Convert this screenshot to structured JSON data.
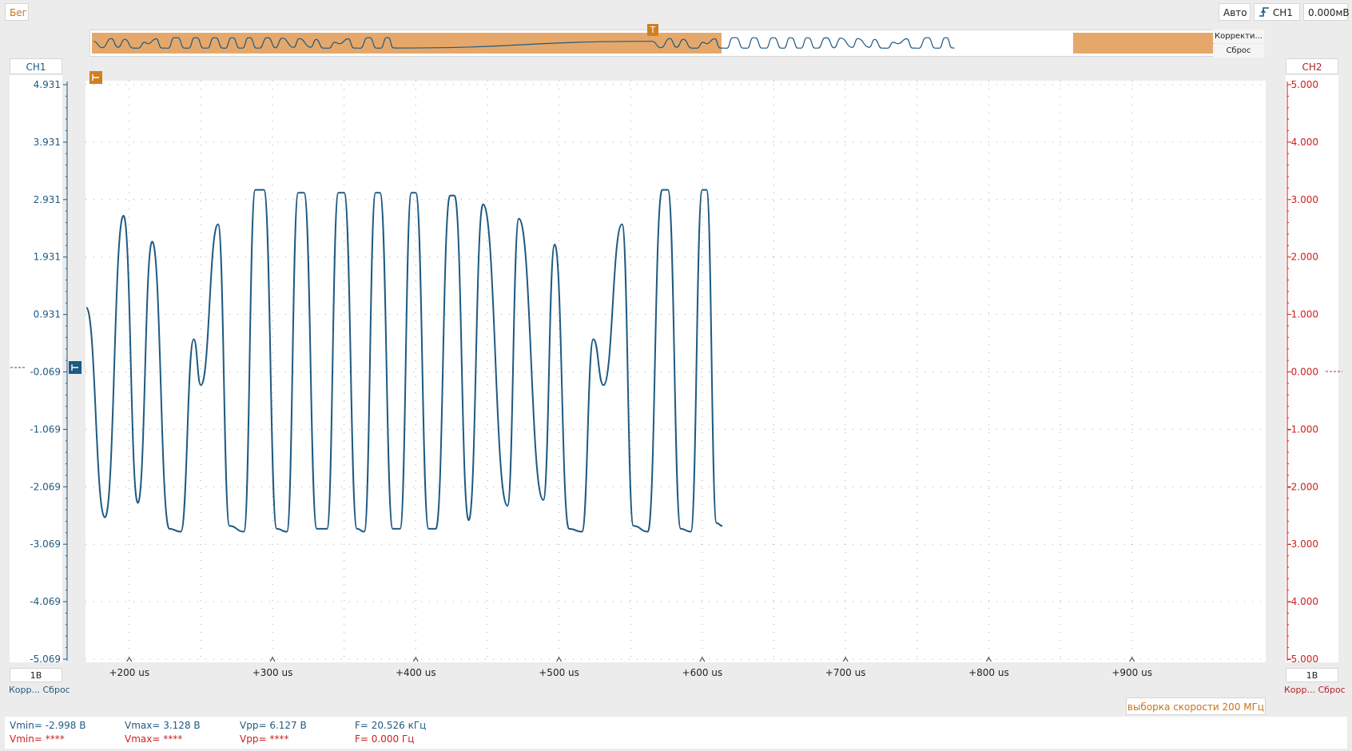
{
  "toolbar": {
    "run_label": "Бег",
    "mode_label": "Авто",
    "trigger_channel": "CH1",
    "trigger_level": "0.000мВ"
  },
  "overview": {
    "adjust_label": "Корректи...",
    "reset_label": "Сброс",
    "selection_color": "#e5a86a",
    "trigger_marker": "T"
  },
  "ch1": {
    "name": "CH1",
    "color": "#1e5a82",
    "ticks": [
      "4.931",
      "3.931",
      "2.931",
      "1.931",
      "0.931",
      "-0.069",
      "-1.069",
      "-2.069",
      "-3.069",
      "-4.069",
      "-5.069"
    ],
    "scale": "1В",
    "adjust_label": "Корр...",
    "reset_label": "Сброс"
  },
  "ch2": {
    "name": "CH2",
    "color": "#cc1f1f",
    "ticks": [
      "5.000",
      "4.000",
      "3.000",
      "2.000",
      "1.000",
      "0.000",
      "-1.000",
      "-2.000",
      "-3.000",
      "-4.000",
      "-5.000"
    ],
    "scale": "1В",
    "adjust_label": "Корр...",
    "reset_label": "Сброс"
  },
  "time_axis": {
    "labels": [
      "+200 us",
      "+300 us",
      "+400 us",
      "+500 us",
      "+600 us",
      "+700 us",
      "+800 us",
      "+900 us"
    ]
  },
  "sample_rate_text": "выборка скорости 200 МГц",
  "measurements": {
    "ch1": {
      "vmin": "Vmin= -2.998 В",
      "vmax": "Vmax= 3.128 В",
      "vpp": "Vpp= 6.127 В",
      "freq": "F= 20.526 кГц"
    },
    "ch2": {
      "vmin": "Vmin= ****",
      "vmax": "Vmax= ****",
      "vpp": "Vpp= ****",
      "freq": "F= 0.000 Гц"
    }
  },
  "chart_data": {
    "type": "line",
    "title": "",
    "xlabel": "",
    "ylabel": "",
    "xlim": [
      170,
      990
    ],
    "ylim": [
      -5.069,
      4.931
    ],
    "x_unit": "us",
    "y_unit": "В",
    "grid": true,
    "series": [
      {
        "name": "CH1",
        "color": "#1e5a82",
        "points": [
          [
            170,
            1.05
          ],
          [
            183,
            -2.6
          ],
          [
            196,
            2.65
          ],
          [
            206,
            -2.35
          ],
          [
            216,
            2.2
          ],
          [
            228,
            -2.8
          ],
          [
            236,
            -2.85
          ],
          [
            245,
            0.5
          ],
          [
            250,
            -0.3
          ],
          [
            262,
            2.5
          ],
          [
            270,
            -2.75
          ],
          [
            280,
            -2.85
          ],
          [
            288,
            3.1
          ],
          [
            294,
            3.1
          ],
          [
            303,
            -2.8
          ],
          [
            310,
            -2.85
          ],
          [
            318,
            3.05
          ],
          [
            322,
            3.05
          ],
          [
            331,
            -2.8
          ],
          [
            338,
            -2.8
          ],
          [
            346,
            3.05
          ],
          [
            350,
            3.05
          ],
          [
            359,
            -2.8
          ],
          [
            364,
            -2.85
          ],
          [
            372,
            3.05
          ],
          [
            375,
            3.05
          ],
          [
            384,
            -2.8
          ],
          [
            389,
            -2.8
          ],
          [
            397,
            3.05
          ],
          [
            400,
            3.05
          ],
          [
            409,
            -2.8
          ],
          [
            414,
            -2.8
          ],
          [
            424,
            3.0
          ],
          [
            427,
            3.0
          ],
          [
            437,
            -2.65
          ],
          [
            447,
            2.85
          ],
          [
            464,
            -2.4
          ],
          [
            472,
            2.6
          ],
          [
            489,
            -2.3
          ],
          [
            497,
            2.15
          ],
          [
            507,
            -2.8
          ],
          [
            516,
            -2.85
          ],
          [
            524,
            0.5
          ],
          [
            531,
            -0.3
          ],
          [
            544,
            2.5
          ],
          [
            552,
            -2.75
          ],
          [
            562,
            -2.85
          ],
          [
            572,
            3.1
          ],
          [
            576,
            3.1
          ],
          [
            585,
            -2.8
          ],
          [
            592,
            -2.85
          ],
          [
            600,
            3.1
          ],
          [
            603,
            3.1
          ],
          [
            610,
            -2.7
          ],
          [
            614,
            -2.75
          ]
        ]
      }
    ]
  }
}
